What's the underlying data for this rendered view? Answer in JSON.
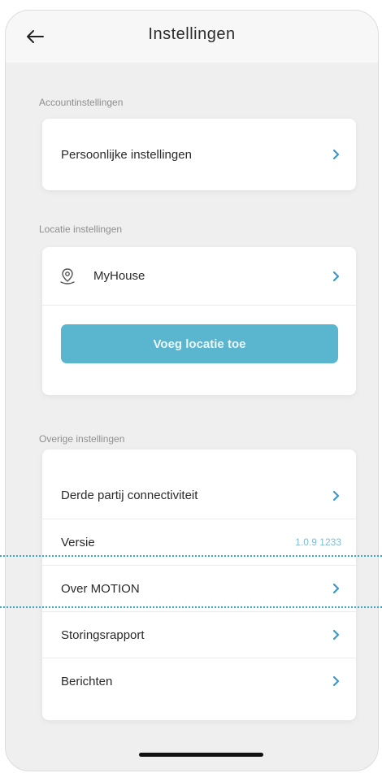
{
  "header": {
    "title": "Instellingen",
    "back_icon": "arrow-left-icon"
  },
  "sections": {
    "account": {
      "label": "Accountinstellingen",
      "items": [
        {
          "label": "Persoonlijke instellingen"
        }
      ]
    },
    "location": {
      "label": "Locatie instellingen",
      "location_name": "MyHouse",
      "location_icon": "map-pin-icon",
      "add_button": "Voeg locatie toe"
    },
    "other": {
      "label": "Overige instellingen",
      "items": [
        {
          "label": "Derde partij connectiviteit"
        },
        {
          "label": "Versie",
          "value": "1.0.9 1233"
        },
        {
          "label": "Over MOTION"
        },
        {
          "label": "Storingsrapport"
        },
        {
          "label": "Berichten"
        }
      ]
    }
  },
  "colors": {
    "accent": "#5ab6cf",
    "chevron": "#3f97c6",
    "background": "#efefef"
  }
}
